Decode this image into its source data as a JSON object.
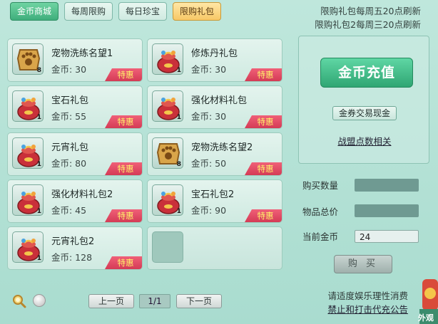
{
  "tabs": [
    {
      "label": "金币商城"
    },
    {
      "label": "每周限购"
    },
    {
      "label": "每日珍宝"
    },
    {
      "label": "限购礼包"
    }
  ],
  "notice": {
    "line1": "限购礼包每周五20点刷新",
    "line2": "限购礼包2每周三20点刷新"
  },
  "items": [
    {
      "name": "宠物洗练名望1",
      "price": "金币: 30",
      "count": "8",
      "badge": "特惠",
      "icon": "paw-token-icon"
    },
    {
      "name": "修炼丹礼包",
      "price": "金币: 30",
      "count": "1",
      "badge": "特惠",
      "icon": "gift-bag-icon"
    },
    {
      "name": "宝石礼包",
      "price": "金币: 55",
      "count": "1",
      "badge": "特惠",
      "icon": "gift-bag-icon"
    },
    {
      "name": "强化材料礼包",
      "price": "金币: 30",
      "count": "1",
      "badge": "特惠",
      "icon": "gift-bag-icon"
    },
    {
      "name": "元宵礼包",
      "price": "金币: 80",
      "count": "1",
      "badge": "特惠",
      "icon": "gift-bag-icon"
    },
    {
      "name": "宠物洗练名望2",
      "price": "金币: 50",
      "count": "8",
      "badge": "特惠",
      "icon": "paw-token-icon"
    },
    {
      "name": "强化材料礼包2",
      "price": "金币: 45",
      "count": "1",
      "badge": "特惠",
      "icon": "gift-bag-icon"
    },
    {
      "name": "宝石礼包2",
      "price": "金币: 90",
      "count": "1",
      "badge": "特惠",
      "icon": "gift-bag-icon"
    },
    {
      "name": "元宵礼包2",
      "price": "金币: 128",
      "count": "1",
      "badge": "特惠",
      "icon": "gift-bag-icon"
    }
  ],
  "panel": {
    "recharge": "金币充值",
    "exchange": "金券交易现金",
    "alliance": "战盟点数相关"
  },
  "purchase": {
    "qty_label": "购买数量",
    "total_label": "物品总价",
    "gold_label": "当前金币",
    "qty_value": "",
    "total_value": "",
    "gold_value": "24",
    "buy_label": "购 买"
  },
  "pager": {
    "prev": "上一页",
    "page": "1/1",
    "next": "下一页"
  },
  "footer": {
    "line1": "请适度娱乐理性消费",
    "line2": "禁止和打击代充公告"
  },
  "corner_label": "外观",
  "colors": {
    "bg": "#bfe7dc",
    "green_button": "#3fae7c",
    "active_tab": "#f7c866",
    "badge": "#d43b55",
    "badge_text": "#fff36a"
  }
}
